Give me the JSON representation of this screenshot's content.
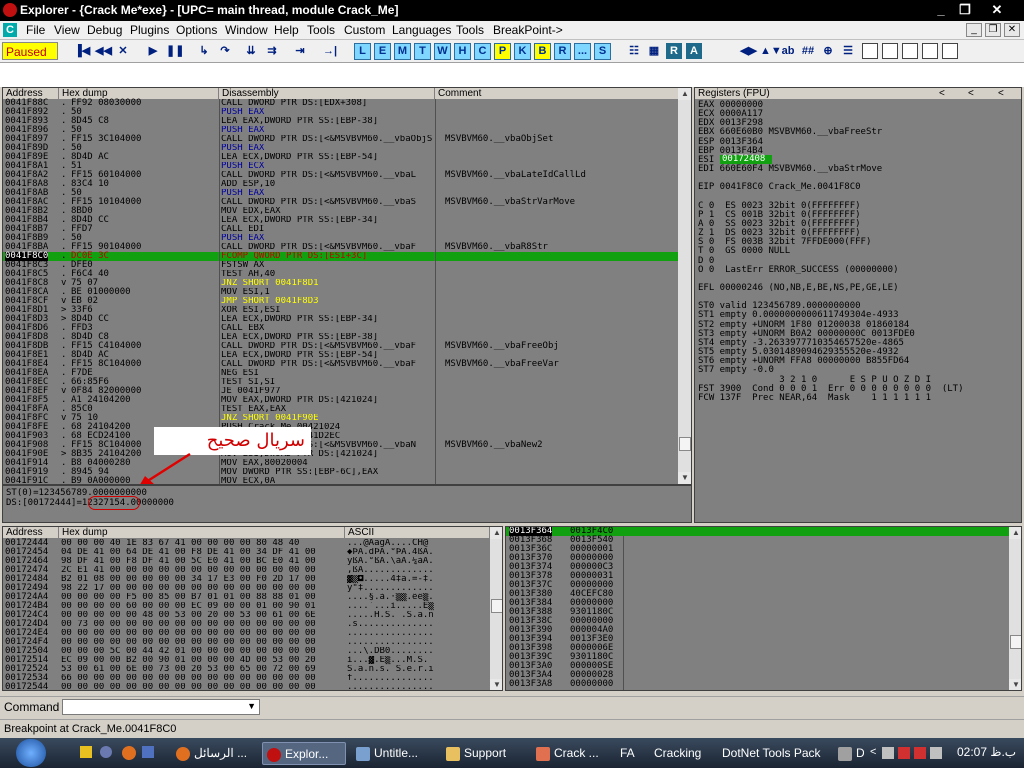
{
  "window": {
    "title": "Explorer - {Crack Me*exe} - [UPC=  main thread, module Crack_Me]",
    "controls": [
      "_",
      "❐",
      "✕"
    ],
    "mdi_controls": [
      "_",
      "❐",
      "✕"
    ]
  },
  "menu": [
    "File",
    "View",
    "Debug",
    "Plugins",
    "Options",
    "Window",
    "Help",
    "Tools",
    "Custom",
    "Languages",
    "Tools",
    "BreakPoint->"
  ],
  "toolbar": {
    "status": "Paused",
    "letter_buttons": [
      "L",
      "E",
      "M",
      "T",
      "W",
      "H",
      "C",
      "P",
      "K",
      "B",
      "R",
      "...",
      "S"
    ],
    "highlight_color": "#ffff00"
  },
  "cpu": {
    "headers": [
      "Address",
      "Hex dump",
      "Disassembly",
      "Comment"
    ],
    "current_row_color": "#10a010",
    "rows": [
      {
        "addr": "0041F88C",
        "m": ".",
        "hex": "FF92 08030000",
        "dis": "CALL DWORD PTR DS:[EDX+308]",
        "cmt": "",
        "style": ""
      },
      {
        "addr": "0041F892",
        "m": ".",
        "hex": "50",
        "dis": "PUSH EAX",
        "cmt": "",
        "style": "blue"
      },
      {
        "addr": "0041F893",
        "m": ".",
        "hex": "8D45 C8",
        "dis": "LEA EAX,DWORD PTR SS:[EBP-38]",
        "cmt": "",
        "style": ""
      },
      {
        "addr": "0041F896",
        "m": ".",
        "hex": "50",
        "dis": "PUSH EAX",
        "cmt": "",
        "style": "blue"
      },
      {
        "addr": "0041F897",
        "m": ".",
        "hex": "FF15 3C104000",
        "dis": "CALL DWORD PTR DS:[<&MSVBVM60.__vbaObjSet",
        "cmt": "MSVBVM60.__vbaObjSet",
        "style": ""
      },
      {
        "addr": "0041F89D",
        "m": ".",
        "hex": "50",
        "dis": "PUSH EAX",
        "cmt": "",
        "style": "blue"
      },
      {
        "addr": "0041F89E",
        "m": ".",
        "hex": "8D4D AC",
        "dis": "LEA ECX,DWORD PTR SS:[EBP-54]",
        "cmt": "",
        "style": ""
      },
      {
        "addr": "0041F8A1",
        "m": ".",
        "hex": "51",
        "dis": "PUSH ECX",
        "cmt": "",
        "style": "blue"
      },
      {
        "addr": "0041F8A2",
        "m": ".",
        "hex": "FF15 60104000",
        "dis": "CALL DWORD PTR DS:[<&MSVBVM60.__vbaL",
        "cmt": "MSVBVM60.__vbaLateIdCallLd",
        "style": ""
      },
      {
        "addr": "0041F8A8",
        "m": ".",
        "hex": "83C4 10",
        "dis": "ADD ESP,10",
        "cmt": "",
        "style": ""
      },
      {
        "addr": "0041F8AB",
        "m": ".",
        "hex": "50",
        "dis": "PUSH EAX",
        "cmt": "",
        "style": "blue"
      },
      {
        "addr": "0041F8AC",
        "m": ".",
        "hex": "FF15 10104000",
        "dis": "CALL DWORD PTR DS:[<&MSVBVM60.__vbaS",
        "cmt": "MSVBVM60.__vbaStrVarMove",
        "style": ""
      },
      {
        "addr": "0041F8B2",
        "m": ".",
        "hex": "8BD0",
        "dis": "MOV EDX,EAX",
        "cmt": "",
        "style": ""
      },
      {
        "addr": "0041F8B4",
        "m": ".",
        "hex": "8D4D CC",
        "dis": "LEA ECX,DWORD PTR SS:[EBP-34]",
        "cmt": "",
        "style": ""
      },
      {
        "addr": "0041F8B7",
        "m": ".",
        "hex": "FFD7",
        "dis": "CALL EDI",
        "cmt": "",
        "style": ""
      },
      {
        "addr": "0041F8B9",
        "m": ".",
        "hex": "50",
        "dis": "PUSH EAX",
        "cmt": "",
        "style": "blue"
      },
      {
        "addr": "0041F8BA",
        "m": ".",
        "hex": "FF15 90104000",
        "dis": "CALL DWORD PTR DS:[<&MSVBVM60.__vbaF",
        "cmt": "MSVBVM60.__vbaR8Str",
        "style": ""
      },
      {
        "addr": "0041F8C0",
        "m": ".",
        "hex": "DC0E 3C",
        "dis": "FCOMP QWORD PTR DS:[ESI+3C]",
        "cmt": "",
        "style": "current"
      },
      {
        "addr": "0041F8C3",
        "m": ".",
        "hex": "DFE0",
        "dis": "FSTSW AX",
        "cmt": "",
        "style": ""
      },
      {
        "addr": "0041F8C5",
        "m": ".",
        "hex": "F6C4 40",
        "dis": "TEST AH,40",
        "cmt": "",
        "style": ""
      },
      {
        "addr": "0041F8C8",
        "m": "v",
        "hex": "75 07",
        "dis": "JNZ SHORT 0041F8D1",
        "cmt": "",
        "style": "yellow"
      },
      {
        "addr": "0041F8CA",
        "m": ".",
        "hex": "BE 01000000",
        "dis": "MOV ESI,1",
        "cmt": "",
        "style": ""
      },
      {
        "addr": "0041F8CF",
        "m": "v",
        "hex": "EB 02",
        "dis": "JMP SHORT 0041F8D3",
        "cmt": "",
        "style": "yellow"
      },
      {
        "addr": "0041F8D1",
        "m": ">",
        "hex": "33F6",
        "dis": "XOR ESI,ESI",
        "cmt": "",
        "style": ""
      },
      {
        "addr": "0041F8D3",
        "m": ">",
        "hex": "8D4D CC",
        "dis": "LEA ECX,DWORD PTR SS:[EBP-34]",
        "cmt": "",
        "style": ""
      },
      {
        "addr": "0041F8D6",
        "m": ".",
        "hex": "FFD3",
        "dis": "CALL EBX",
        "cmt": "",
        "style": ""
      },
      {
        "addr": "0041F8D8",
        "m": ".",
        "hex": "8D4D C8",
        "dis": "LEA ECX,DWORD PTR SS:[EBP-38]",
        "cmt": "",
        "style": ""
      },
      {
        "addr": "0041F8DB",
        "m": ".",
        "hex": "FF15 C4104000",
        "dis": "CALL DWORD PTR DS:[<&MSVBVM60.__vbaF",
        "cmt": "MSVBVM60.__vbaFreeObj",
        "style": ""
      },
      {
        "addr": "0041F8E1",
        "m": ".",
        "hex": "8D4D AC",
        "dis": "LEA ECX,DWORD PTR SS:[EBP-54]",
        "cmt": "",
        "style": ""
      },
      {
        "addr": "0041F8E4",
        "m": ".",
        "hex": "FF15 8C104000",
        "dis": "CALL DWORD PTR DS:[<&MSVBVM60.__vbaF",
        "cmt": "MSVBVM60.__vbaFreeVar",
        "style": ""
      },
      {
        "addr": "0041F8EA",
        "m": ".",
        "hex": "F7DE",
        "dis": "NEG ESI",
        "cmt": "",
        "style": ""
      },
      {
        "addr": "0041F8EC",
        "m": ".",
        "hex": "66:85F6",
        "dis": "TEST SI,SI",
        "cmt": "",
        "style": ""
      },
      {
        "addr": "0041F8EF",
        "m": "v",
        "hex": "0F84 82000000",
        "dis": "JE 0041F977",
        "cmt": "",
        "style": ""
      },
      {
        "addr": "0041F8F5",
        "m": ".",
        "hex": "A1 24104200",
        "dis": "MOV EAX,DWORD PTR DS:[421024]",
        "cmt": "",
        "style": ""
      },
      {
        "addr": "0041F8FA",
        "m": ".",
        "hex": "85C0",
        "dis": "TEST EAX,EAX",
        "cmt": "",
        "style": ""
      },
      {
        "addr": "0041F8FC",
        "m": "v",
        "hex": "75 10",
        "dis": "JNZ SHORT 0041F90E",
        "cmt": "",
        "style": "yellow"
      },
      {
        "addr": "0041F8FE",
        "m": ".",
        "hex": "68 24104200",
        "dis": "PUSH Crack_Me.00421024",
        "cmt": "",
        "style": ""
      },
      {
        "addr": "0041F903",
        "m": ".",
        "hex": "68 ECD24100",
        "dis": "PUSH Crack_Me.0041D2EC",
        "cmt": "",
        "style": ""
      },
      {
        "addr": "0041F908",
        "m": ".",
        "hex": "FF15 8C104000",
        "dis": "CALL DWORD PTR DS:[<&MSVBVM60.__vbaN",
        "cmt": "MSVBVM60.__vbaNew2",
        "style": ""
      },
      {
        "addr": "0041F90E",
        "m": ">",
        "hex": "8B35 24104200",
        "dis": "MOV ESI,DWORD PTR DS:[421024]",
        "cmt": "",
        "style": ""
      },
      {
        "addr": "0041F914",
        "m": ".",
        "hex": "B8 04000280",
        "dis": "MOV EAX,80020004",
        "cmt": "",
        "style": ""
      },
      {
        "addr": "0041F919",
        "m": ".",
        "hex": "8945 94",
        "dis": "MOV DWORD PTR SS:[EBP-6C],EAX",
        "cmt": "",
        "style": ""
      },
      {
        "addr": "0041F91C",
        "m": ".",
        "hex": "B9 0A000000",
        "dis": "MOV ECX,0A",
        "cmt": "",
        "style": ""
      }
    ],
    "info": [
      "ST(0)=123456789.0000000000",
      "DS:[00172444]=12327154.00000000"
    ],
    "annotation": "سريال صحيح"
  },
  "registers": {
    "header": "Registers (FPU)",
    "nav": [
      "<",
      "<",
      "<"
    ],
    "esi_value": "00172408",
    "lines": [
      "EAX 00000000",
      "ECX 0000A117",
      "EDX 0013F298",
      "EBX 660E60B0 MSVBVM60.__vbaFreeStr",
      "ESP 0013F364",
      "EBP 0013F4B4",
      "ESI 00172408",
      "EDI 660E60F4 MSVBVM60.__vbaStrMove",
      "",
      "EIP 0041F8C0 Crack_Me.0041F8C0",
      "",
      "C 0  ES 0023 32bit 0(FFFFFFFF)",
      "P 1  CS 001B 32bit 0(FFFFFFFF)",
      "A 0  SS 0023 32bit 0(FFFFFFFF)",
      "Z 1  DS 0023 32bit 0(FFFFFFFF)",
      "S 0  FS 003B 32bit 7FFDE000(FFF)",
      "T 0  GS 0000 NULL",
      "D 0",
      "O 0  LastErr ERROR_SUCCESS (00000000)",
      "",
      "EFL 00000246 (NO,NB,E,BE,NS,PE,GE,LE)",
      "",
      "ST0 valid 123456789.0000000000",
      "ST1 empty 0.0000000000611749304e-4933",
      "ST2 empty +UNORM 1F80 01200038 01860184",
      "ST3 empty +UNORM B0A2 00000000C 0013FDE0",
      "ST4 empty -3.2633977710354657520e-4865",
      "ST5 empty 5.0301489094629355520e-4932",
      "ST6 empty +UNORM FFA8 00000000 B855FD64",
      "ST7 empty -0.0",
      "               3 2 1 0      E S P U O Z D I",
      "FST 3900  Cond 0 0 0 1  Err 0 0 0 0 0 0 0 0  (LT)",
      "FCW 137F  Prec NEAR,64  Mask    1 1 1 1 1 1"
    ]
  },
  "dump": {
    "headers": [
      "Address",
      "Hex dump",
      "ASCII"
    ],
    "rows": [
      [
        "00172444",
        "00 00 00 40 1E 83 67 41 00 00 00 00 80 48 40",
        "...@AägA....CH@"
      ],
      [
        "00172454",
        "04 DE 41 00 64 DE 41 00 F8 DE 41 00 34 DF 41 00",
        "◆ÞA.dÞA.°ÞA.4ßA."
      ],
      [
        "00172464",
        "98 DF 41 00 F8 DF 41 00 5C E0 41 00 BC E0 41 00",
        "ÿßA.°ßA.\\àA.¼àA."
      ],
      [
        "00172474",
        "2C E1 41 00 00 00 00 00 00 00 00 00 00 00 00 00",
        ",ßA............."
      ],
      [
        "00172484",
        "B2 01 08 00 00 00 00 00 34 17 E3 00 F0 2D 17 00",
        "▓▒◘.....4‡ã.=-‡."
      ],
      [
        "00172494",
        "98 22 17 00 00 00 00 00 00 00 00 00 00 00 00 00",
        "ÿ\"‡............."
      ],
      [
        "001724A4",
        "00 00 00 00 F5 00 85 00 B7 01 01 00 88 88 01 00",
        "....§.à.·▒▒.êê▒."
      ],
      [
        "001724B4",
        "00 00 00 00 60 00 00 00 EC 09 00 00 01 00 90 01",
        "....`...ì.....É▒"
      ],
      [
        "001724C4",
        "00 00 00 00 00 48 00 53 00 20 00 53 00 61 00 6E",
        ".....H.S. .S.a.n"
      ],
      [
        "001724D4",
        "00 73 00 00 00 00 00 00 00 00 00 00 00 00 00 00",
        ".s.............."
      ],
      [
        "001724E4",
        "00 00 00 00 00 00 00 00 00 00 00 00 00 00 00 00",
        "................"
      ],
      [
        "001724F4",
        "00 00 00 00 00 00 00 00 00 00 00 00 00 00 00 00",
        "................"
      ],
      [
        "00172504",
        "00 00 00 5C 00 44 42 01 00 00 00 00 00 00 00 00",
        "...\\.DB0........"
      ],
      [
        "00172514",
        "EC 09 00 00 B2 00 90 01 00 00 00 4D 00 53 00 20",
        "ì...▓.É▒...M.S. "
      ],
      [
        "00172524",
        "53 00 61 00 6E 00 73 00 20 53 00 65 00 72 00 69",
        "S.a.n.s. S.e.r.i"
      ],
      [
        "00172534",
        "66 00 00 00 00 00 00 00 00 00 00 00 00 00 00 00",
        "f..............."
      ],
      [
        "00172544",
        "00 00 00 00 00 00 00 00 00 00 00 00 00 00 00 00",
        "................"
      ]
    ]
  },
  "stack": {
    "rows": [
      [
        "0013F364",
        "0013F4C0"
      ],
      [
        "0013F368",
        "0013F540"
      ],
      [
        "0013F36C",
        "00000001"
      ],
      [
        "0013F370",
        "00000000"
      ],
      [
        "0013F374",
        "000000C3"
      ],
      [
        "0013F378",
        "00000031"
      ],
      [
        "0013F37C",
        "00000000"
      ],
      [
        "0013F380",
        "40CEFC80"
      ],
      [
        "0013F384",
        "00000000"
      ],
      [
        "0013F388",
        "9301180C"
      ],
      [
        "0013F38C",
        "00000000"
      ],
      [
        "0013F390",
        "000004A0"
      ],
      [
        "0013F394",
        "0013F3E0"
      ],
      [
        "0013F398",
        "0000006E"
      ],
      [
        "0013F39C",
        "9301180C"
      ],
      [
        "0013F3A0",
        "000000SE"
      ],
      [
        "0013F3A4",
        "00000028"
      ],
      [
        "0013F3A8",
        "00000000"
      ]
    ]
  },
  "command": {
    "label": "Command :",
    "value": ""
  },
  "status": "Breakpoint at Crack_Me.0041F8C0",
  "taskbar": {
    "items": [
      "الرسائل ...",
      "Explor...",
      "Untitle...",
      "Support",
      "Crack ...",
      "FA",
      "Cracking",
      "DotNet Tools Pack",
      "D"
    ],
    "clock": "02:07 ب.ظ"
  }
}
